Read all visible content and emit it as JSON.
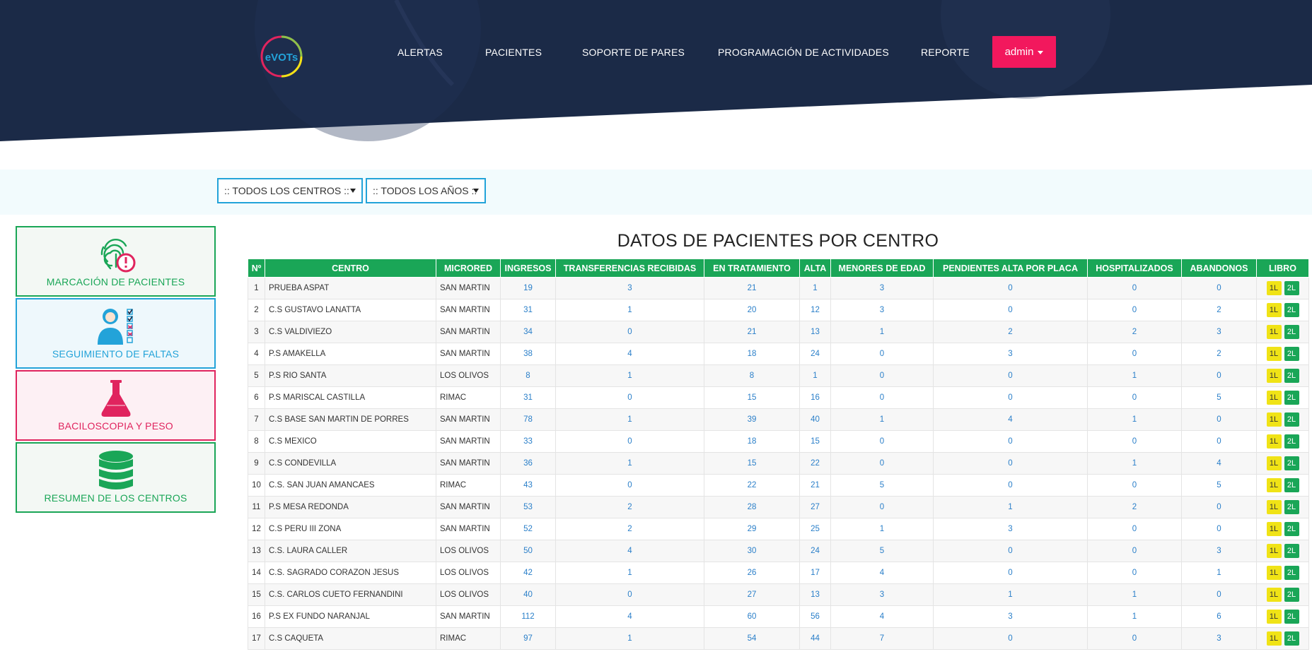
{
  "header": {
    "logo_text": "eVOTs",
    "nav": [
      "ALERTAS",
      "PACIENTES",
      "SOPORTE DE PARES",
      "PROGRAMACIÓN DE ACTIVIDADES",
      "REPORTE"
    ],
    "user_label": "admin",
    "colors": {
      "navy": "#1b2a47",
      "accent": "#f2185d"
    }
  },
  "filters": {
    "centro": ":: TODOS LOS CENTROS ::",
    "anio": ":: TODOS LOS AÑOS ::"
  },
  "sidebar": [
    {
      "label": "MARCACIÓN DE PACIENTES",
      "icon": "fingerprint-alert-icon",
      "color": "#1aa657"
    },
    {
      "label": "SEGUIMIENTO DE FALTAS",
      "icon": "user-checklist-icon",
      "color": "#23a3d9"
    },
    {
      "label": "BACILOSCOPIA Y PESO",
      "icon": "flask-icon",
      "color": "#e0245e"
    },
    {
      "label": "RESUMEN DE LOS CENTROS",
      "icon": "database-icon",
      "color": "#1aa657"
    }
  ],
  "table": {
    "title": "DATOS DE PACIENTES POR CENTRO",
    "headers": [
      "Nº",
      "CENTRO",
      "MICRORED",
      "INGRESOS",
      "TRANSFERENCIAS RECIBIDAS",
      "EN TRATAMIENTO",
      "ALTA",
      "MENORES DE EDAD",
      "PENDIENTES ALTA POR PLACA",
      "HOSPITALIZADOS",
      "ABANDONOS",
      "LIBRO"
    ],
    "libro_labels": [
      "1L",
      "2L"
    ],
    "rows": [
      [
        "1",
        "PRUEBA ASPAT",
        "SAN MARTIN",
        "19",
        "3",
        "21",
        "1",
        "3",
        "0",
        "0",
        "0"
      ],
      [
        "2",
        "C.S GUSTAVO LANATTA",
        "SAN MARTIN",
        "31",
        "1",
        "20",
        "12",
        "3",
        "0",
        "0",
        "2"
      ],
      [
        "3",
        "C.S VALDIVIEZO",
        "SAN MARTIN",
        "34",
        "0",
        "21",
        "13",
        "1",
        "2",
        "2",
        "3"
      ],
      [
        "4",
        "P.S AMAKELLA",
        "SAN MARTIN",
        "38",
        "4",
        "18",
        "24",
        "0",
        "3",
        "0",
        "2"
      ],
      [
        "5",
        "P.S RIO SANTA",
        "LOS OLIVOS",
        "8",
        "1",
        "8",
        "1",
        "0",
        "0",
        "1",
        "0"
      ],
      [
        "6",
        "P.S MARISCAL CASTILLA",
        "RIMAC",
        "31",
        "0",
        "15",
        "16",
        "0",
        "0",
        "0",
        "5"
      ],
      [
        "7",
        "C.S BASE SAN MARTIN DE PORRES",
        "SAN MARTIN",
        "78",
        "1",
        "39",
        "40",
        "1",
        "4",
        "1",
        "0"
      ],
      [
        "8",
        "C.S MEXICO",
        "SAN MARTIN",
        "33",
        "0",
        "18",
        "15",
        "0",
        "0",
        "0",
        "0"
      ],
      [
        "9",
        "C.S CONDEVILLA",
        "SAN MARTIN",
        "36",
        "1",
        "15",
        "22",
        "0",
        "0",
        "1",
        "4"
      ],
      [
        "10",
        "C.S. SAN JUAN AMANCAES",
        "RIMAC",
        "43",
        "0",
        "22",
        "21",
        "5",
        "0",
        "0",
        "5"
      ],
      [
        "11",
        "P.S MESA REDONDA",
        "SAN MARTIN",
        "53",
        "2",
        "28",
        "27",
        "0",
        "1",
        "2",
        "0"
      ],
      [
        "12",
        "C.S PERU III ZONA",
        "SAN MARTIN",
        "52",
        "2",
        "29",
        "25",
        "1",
        "3",
        "0",
        "0"
      ],
      [
        "13",
        "C.S. LAURA CALLER",
        "LOS OLIVOS",
        "50",
        "4",
        "30",
        "24",
        "5",
        "0",
        "0",
        "3"
      ],
      [
        "14",
        "C.S. SAGRADO CORAZON JESUS",
        "LOS OLIVOS",
        "42",
        "1",
        "26",
        "17",
        "4",
        "0",
        "0",
        "1"
      ],
      [
        "15",
        "C.S. CARLOS CUETO FERNANDINI",
        "LOS OLIVOS",
        "40",
        "0",
        "27",
        "13",
        "3",
        "1",
        "1",
        "0"
      ],
      [
        "16",
        "P.S EX FUNDO NARANJAL",
        "SAN MARTIN",
        "112",
        "4",
        "60",
        "56",
        "4",
        "3",
        "1",
        "6"
      ],
      [
        "17",
        "C.S CAQUETA",
        "RIMAC",
        "97",
        "1",
        "54",
        "44",
        "7",
        "0",
        "0",
        "3"
      ]
    ]
  }
}
